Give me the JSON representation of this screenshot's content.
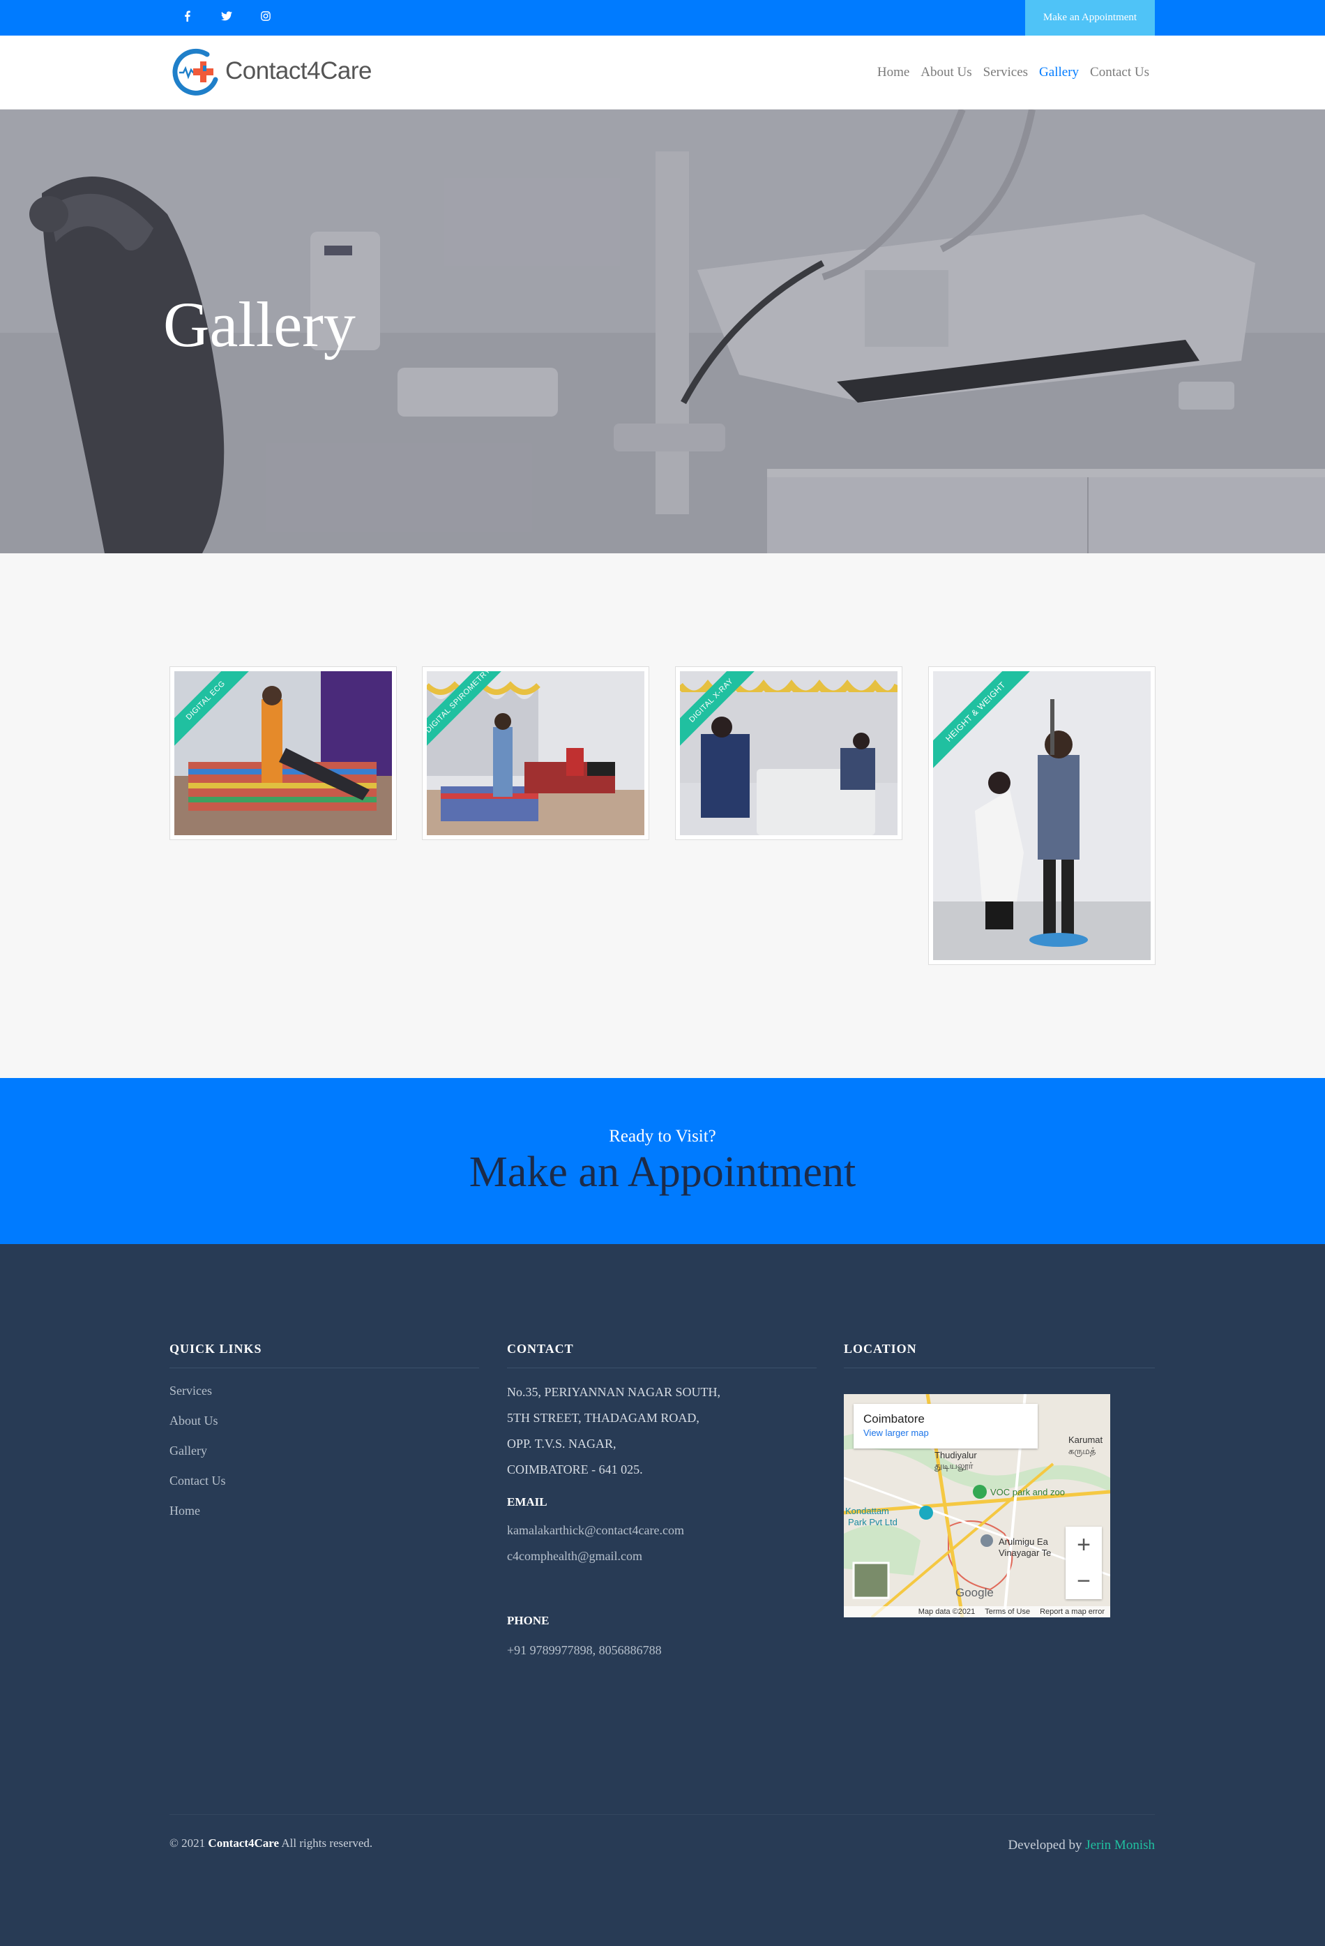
{
  "topbar": {
    "social": [
      {
        "icon": "facebook-icon",
        "glyph": "f"
      },
      {
        "icon": "twitter-icon",
        "glyph": "🐦"
      },
      {
        "icon": "instagram-icon",
        "glyph": "◎"
      }
    ],
    "appointment_label": "Make an Appointment"
  },
  "header": {
    "brand": "Contact4Care",
    "nav": [
      {
        "label": "Home",
        "active": false
      },
      {
        "label": "About Us",
        "active": false
      },
      {
        "label": "Services",
        "active": false
      },
      {
        "label": "Gallery",
        "active": true
      },
      {
        "label": "Contact Us",
        "active": false
      }
    ]
  },
  "hero": {
    "title": "Gallery"
  },
  "gallery": {
    "items": [
      {
        "ribbon": "DIGITAL ECG"
      },
      {
        "ribbon": "DIGITAL SPIROMETRY"
      },
      {
        "ribbon": "DIGITAL X-RAY"
      },
      {
        "ribbon": "HEIGHT & WEIGHT"
      }
    ]
  },
  "cta": {
    "subtitle": "Ready to Visit?",
    "title": "Make an Appointment"
  },
  "footer": {
    "quick_links": {
      "heading": "QUICK LINKS",
      "items": [
        "Services",
        "About Us",
        "Gallery",
        "Contact Us",
        "Home"
      ]
    },
    "contact": {
      "heading": "CONTACT",
      "address": [
        "No.35, PERIYANNAN NAGAR SOUTH,",
        "5TH STREET, THADAGAM ROAD,",
        "OPP. T.V.S. NAGAR,",
        "COIMBATORE - 641 025."
      ],
      "email_heading": "EMAIL",
      "emails": [
        "kamalakarthick@contact4care.com",
        "c4comphealth@gmail.com"
      ],
      "phone_heading": "PHONE",
      "phone": "+91 9789977898, 8056886788"
    },
    "location": {
      "heading": "LOCATION",
      "map_title": "Coimbatore",
      "map_link": "View larger map",
      "map_labels": [
        "Thudiyalur",
        "துடியலூர்",
        "VOC park and zoo",
        "Kondattam",
        "Park Pvt Ltd",
        "Arulmigu Ea",
        "Vinayagar Te",
        "Karumat",
        "கருமத்"
      ],
      "zoom_in": "+",
      "zoom_out": "−",
      "attribution": [
        "Map data ©2021",
        "Terms of Use",
        "Report a map error"
      ],
      "google": "Google"
    },
    "copyright_prefix": "© 2021",
    "copyright_brand": "Contact4Care",
    "copyright_suffix": "All rights reserved.",
    "developed_prefix": "Developed by",
    "developer": "Jerin Monish"
  },
  "colors": {
    "primary": "#007bff",
    "accent": "#20c0a0",
    "footer_bg": "#283b55",
    "cta_title": "#1c2b49"
  }
}
